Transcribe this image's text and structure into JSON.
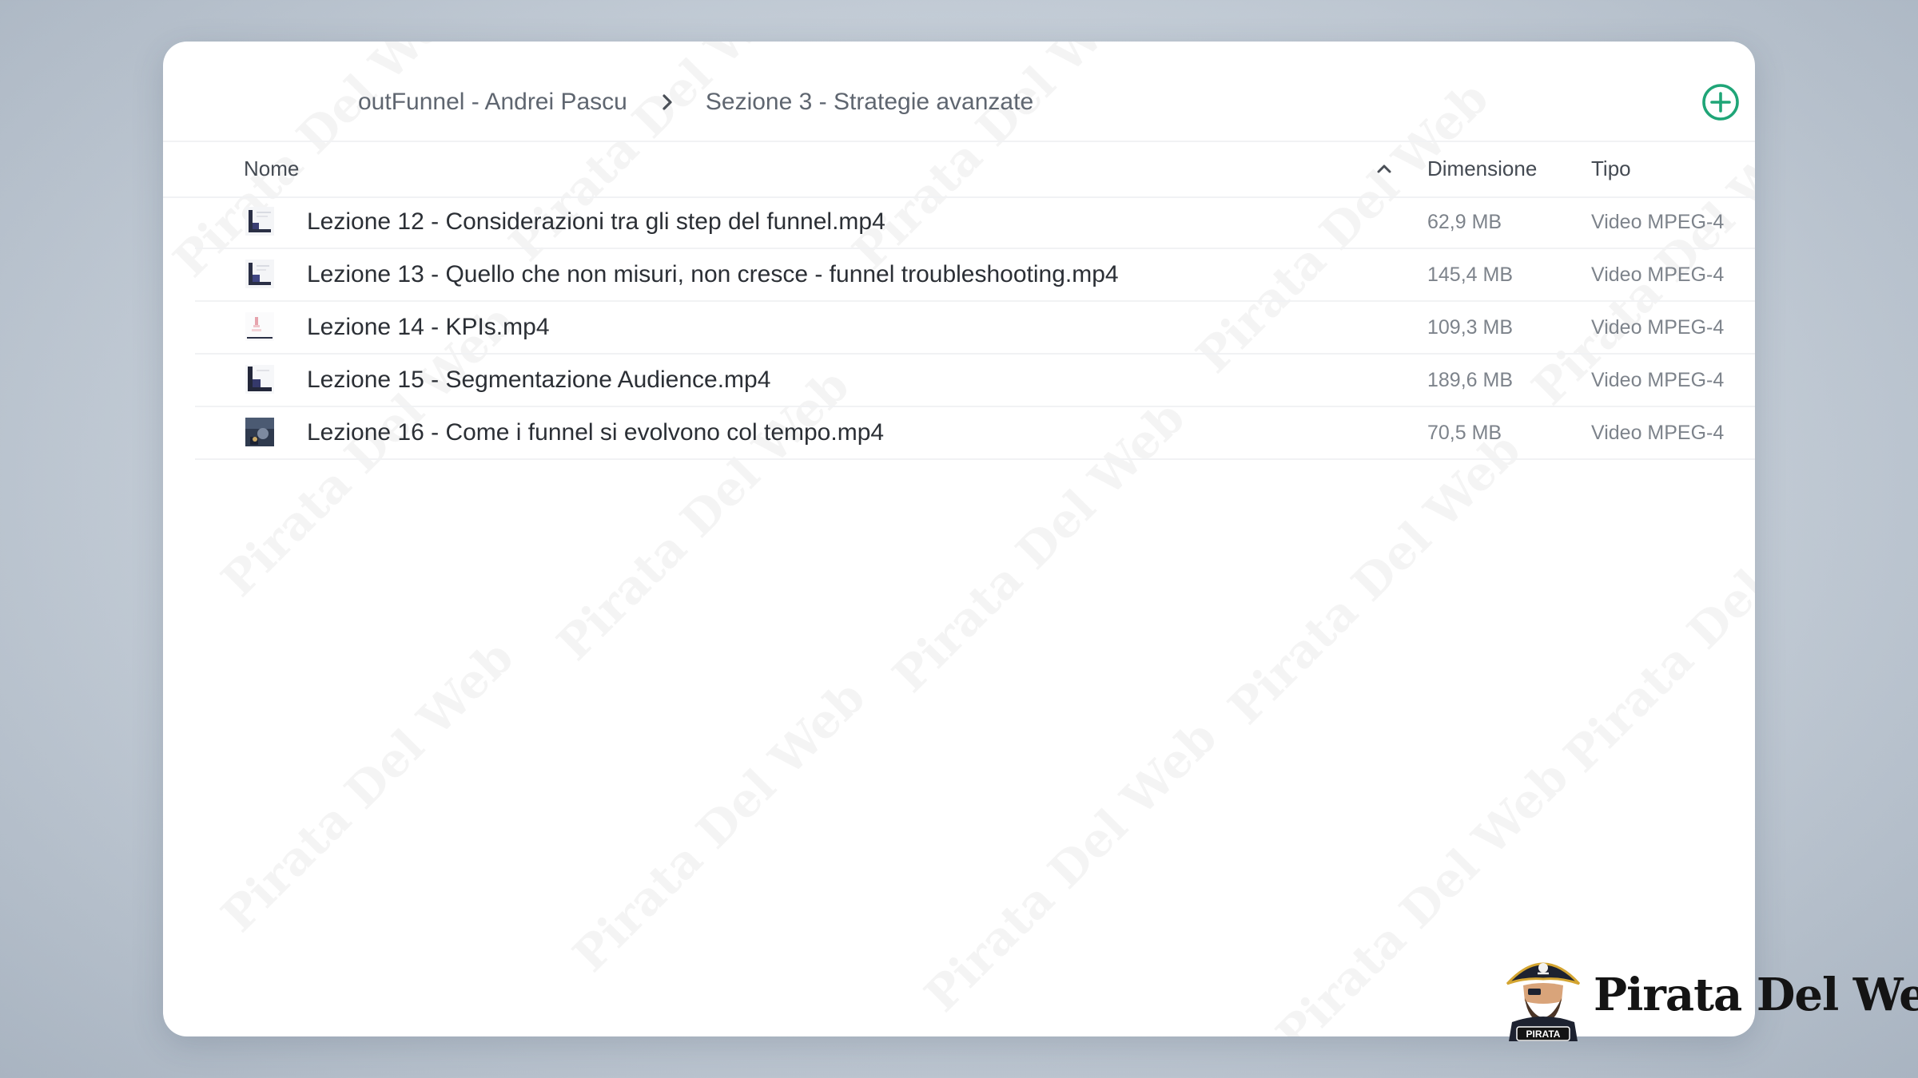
{
  "breadcrumb": {
    "items": [
      {
        "label": "outFunnel - Andrei Pascu"
      },
      {
        "label": "Sezione 3 - Strategie avanzate"
      }
    ]
  },
  "actions": {
    "add_icon": "plus-circle-icon",
    "accent_color": "#1fa577"
  },
  "table": {
    "columns": {
      "name": "Nome",
      "size": "Dimensione",
      "type": "Tipo"
    },
    "sort": {
      "column": "name",
      "direction": "ascending",
      "icon": "chevron-up-icon"
    },
    "rows": [
      {
        "name": "Lezione 12 - Considerazioni tra gli step del funnel.mp4",
        "size": "62,9 MB",
        "type": "Video MPEG-4",
        "thumbnail": "video-thumbnail"
      },
      {
        "name": "Lezione 13 - Quello che non misuri, non cresce - funnel troubleshooting.mp4",
        "size": "145,4 MB",
        "type": "Video MPEG-4",
        "thumbnail": "video-thumbnail"
      },
      {
        "name": "Lezione 14 - KPIs.mp4",
        "size": "109,3 MB",
        "type": "Video MPEG-4",
        "thumbnail": "video-thumbnail"
      },
      {
        "name": "Lezione 15 - Segmentazione Audience.mp4",
        "size": "189,6 MB",
        "type": "Video MPEG-4",
        "thumbnail": "video-thumbnail"
      },
      {
        "name": "Lezione 16 - Come i funnel si evolvono col tempo.mp4",
        "size": "70,5 MB",
        "type": "Video MPEG-4",
        "thumbnail": "video-thumbnail"
      }
    ]
  },
  "watermark": {
    "text": "Pirata Del Web"
  },
  "logo": {
    "text": "Pirata Del Web",
    "badge": "PIRATA"
  }
}
